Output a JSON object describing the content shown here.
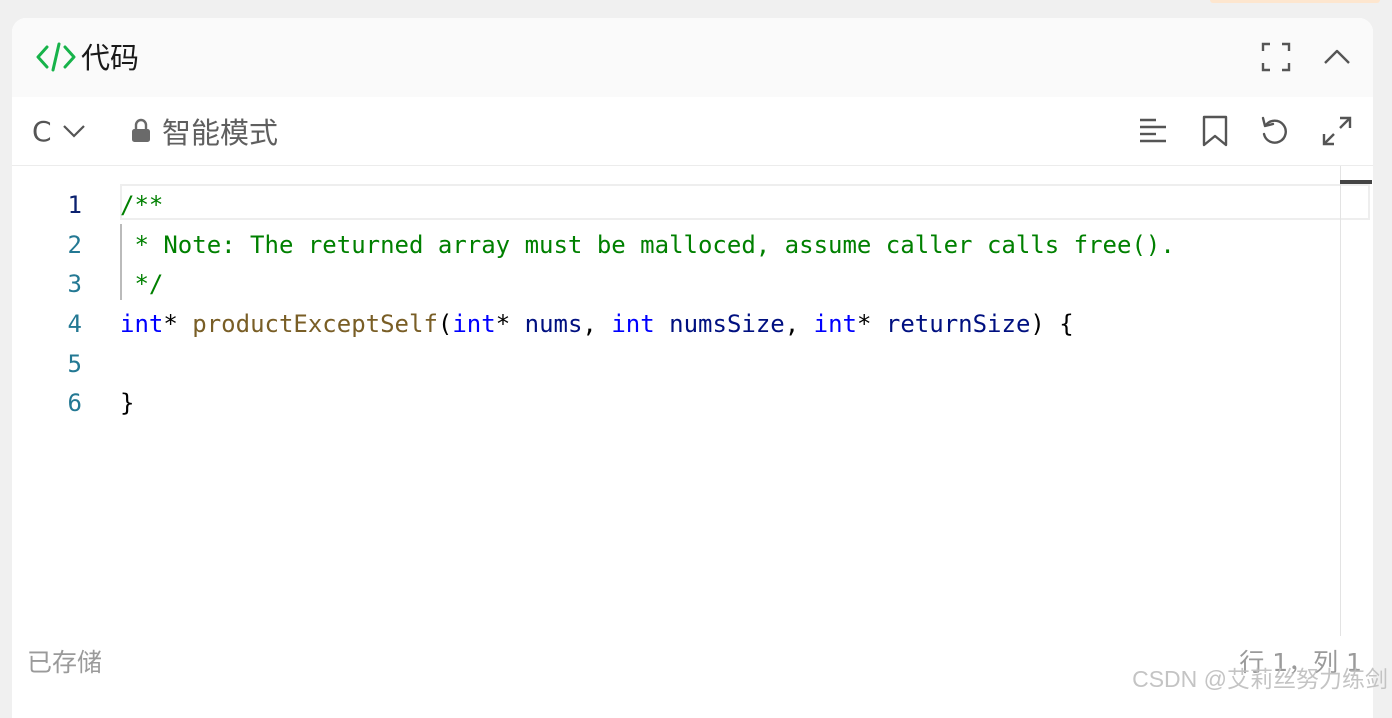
{
  "panel": {
    "title": "代码",
    "icons": [
      "code-brackets-icon",
      "fullscreen-icon",
      "collapse-chevron-up-icon"
    ]
  },
  "toolbar": {
    "language": "C",
    "mode_label": "智能模式",
    "icons": [
      "lock-icon",
      "format-lines-icon",
      "bookmark-icon",
      "reset-icon",
      "expand-icon"
    ]
  },
  "editor": {
    "line_numbers": [
      "1",
      "2",
      "3",
      "4",
      "5",
      "6"
    ],
    "active_line": 1,
    "lines": [
      [
        {
          "t": "/**",
          "c": "comment"
        }
      ],
      [
        {
          "t": " * Note: The returned array must be malloced, assume caller calls free().",
          "c": "comment"
        }
      ],
      [
        {
          "t": " */",
          "c": "comment"
        }
      ],
      [
        {
          "t": "int",
          "c": "kw"
        },
        {
          "t": "* ",
          "c": "punc"
        },
        {
          "t": "productExceptSelf",
          "c": "fn"
        },
        {
          "t": "(",
          "c": "punc"
        },
        {
          "t": "int",
          "c": "kw"
        },
        {
          "t": "* ",
          "c": "punc"
        },
        {
          "t": "nums",
          "c": "var"
        },
        {
          "t": ", ",
          "c": "punc"
        },
        {
          "t": "int",
          "c": "kw"
        },
        {
          "t": " ",
          "c": "punc"
        },
        {
          "t": "numsSize",
          "c": "var"
        },
        {
          "t": ", ",
          "c": "punc"
        },
        {
          "t": "int",
          "c": "kw"
        },
        {
          "t": "* ",
          "c": "punc"
        },
        {
          "t": "returnSize",
          "c": "var"
        },
        {
          "t": ") {",
          "c": "punc"
        }
      ],
      [
        {
          "t": "",
          "c": "punc"
        }
      ],
      [
        {
          "t": "}",
          "c": "punc"
        }
      ]
    ]
  },
  "status": {
    "saved": "已存储",
    "cursor": "行 1，列 1"
  },
  "watermark": "CSDN @艾莉丝努力练剑",
  "colors": {
    "accent_green": "#17b34a",
    "comment": "#008000",
    "keyword": "#0000ff",
    "function": "#795e26",
    "variable": "#001080",
    "line_number": "#237893"
  }
}
